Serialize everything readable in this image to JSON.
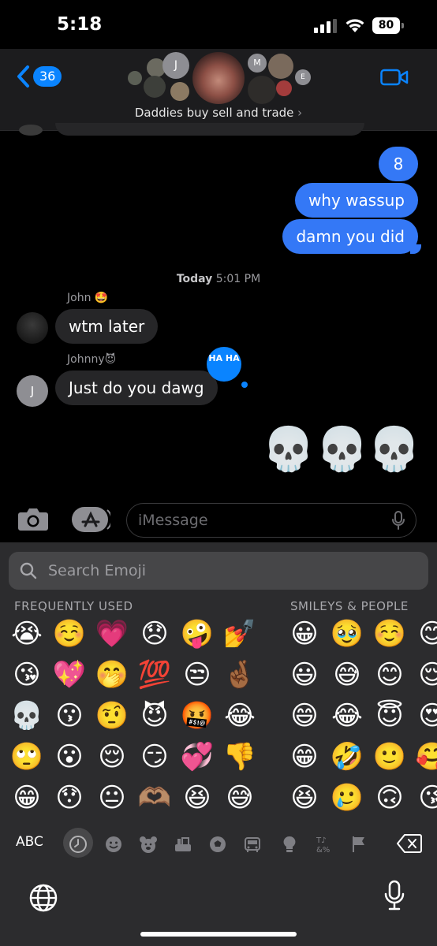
{
  "status_bar": {
    "time": "5:18",
    "battery": "80"
  },
  "header": {
    "back_count": "36",
    "group_name": "Daddies buy sell and trade",
    "avatar_initials": [
      "J",
      "M",
      "E"
    ]
  },
  "thread": {
    "outgoing": [
      "8",
      "why wassup",
      "damn you did"
    ],
    "timestamp_day": "Today",
    "timestamp_time": "5:01 PM",
    "messages": [
      {
        "sender": "John 🤩",
        "text": "wtm later"
      },
      {
        "sender": "Johnny😈",
        "text": "Just do you dawg",
        "avatar_initial": "J"
      }
    ],
    "tapback": "HA HA",
    "reaction_emoji": [
      "💀",
      "💀",
      "💀"
    ]
  },
  "composer": {
    "placeholder": "iMessage"
  },
  "keyboard": {
    "search_placeholder": "Search Emoji",
    "section_frequent": "FREQUENTLY USED",
    "section_smileys": "SMILEYS & PEOPLE",
    "frequent": [
      [
        "😭",
        "☺️",
        "💗",
        "😞",
        "🤪",
        "💅"
      ],
      [
        "😘",
        "💖",
        "🤭",
        "💯",
        "😒",
        "🤞🏾"
      ],
      [
        "💀",
        "😗",
        "🤨",
        "😈",
        "🤬",
        "😂"
      ],
      [
        "🙄",
        "😮",
        "😌",
        "😏",
        "💞",
        "👎"
      ],
      [
        "😁",
        "😯",
        "😐",
        "🫶🏽",
        "😆",
        "😅"
      ]
    ],
    "smileys": [
      [
        "😀",
        "🥹",
        "☺️",
        "😊"
      ],
      [
        "😃",
        "😅",
        "😊",
        "😌"
      ],
      [
        "😄",
        "😂",
        "😇",
        "😍"
      ],
      [
        "😁",
        "🤣",
        "🙂",
        "🥰"
      ],
      [
        "😆",
        "🥲",
        "🙃",
        "😘"
      ]
    ],
    "abc_label": "ABC",
    "categories": [
      "recent-icon",
      "smiley-icon",
      "animal-icon",
      "food-icon",
      "activity-icon",
      "travel-icon",
      "objects-icon",
      "symbols-icon",
      "flags-icon"
    ]
  }
}
